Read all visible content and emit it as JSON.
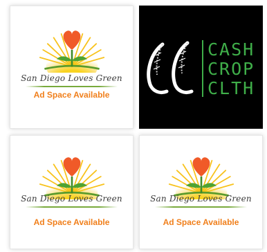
{
  "ads": [
    {
      "type": "placeholder",
      "brand": "San Diego Loves Green",
      "cta": "Ad Space Available"
    },
    {
      "type": "brand-ad",
      "lines": [
        "CASH",
        "CROP",
        "CLTH"
      ]
    },
    {
      "type": "placeholder",
      "brand": "San Diego Loves Green",
      "cta": "Ad Space Available"
    },
    {
      "type": "placeholder",
      "brand": "San Diego Loves Green",
      "cta": "Ad Space Available"
    }
  ],
  "colors": {
    "heart": "#f05a28",
    "sun": "#f9c40f",
    "leaf_green": "#3fae49",
    "cta_orange": "#f07f1b"
  },
  "icons": [
    "heart-sprout-sun-logo",
    "cc-monogram-logo"
  ]
}
